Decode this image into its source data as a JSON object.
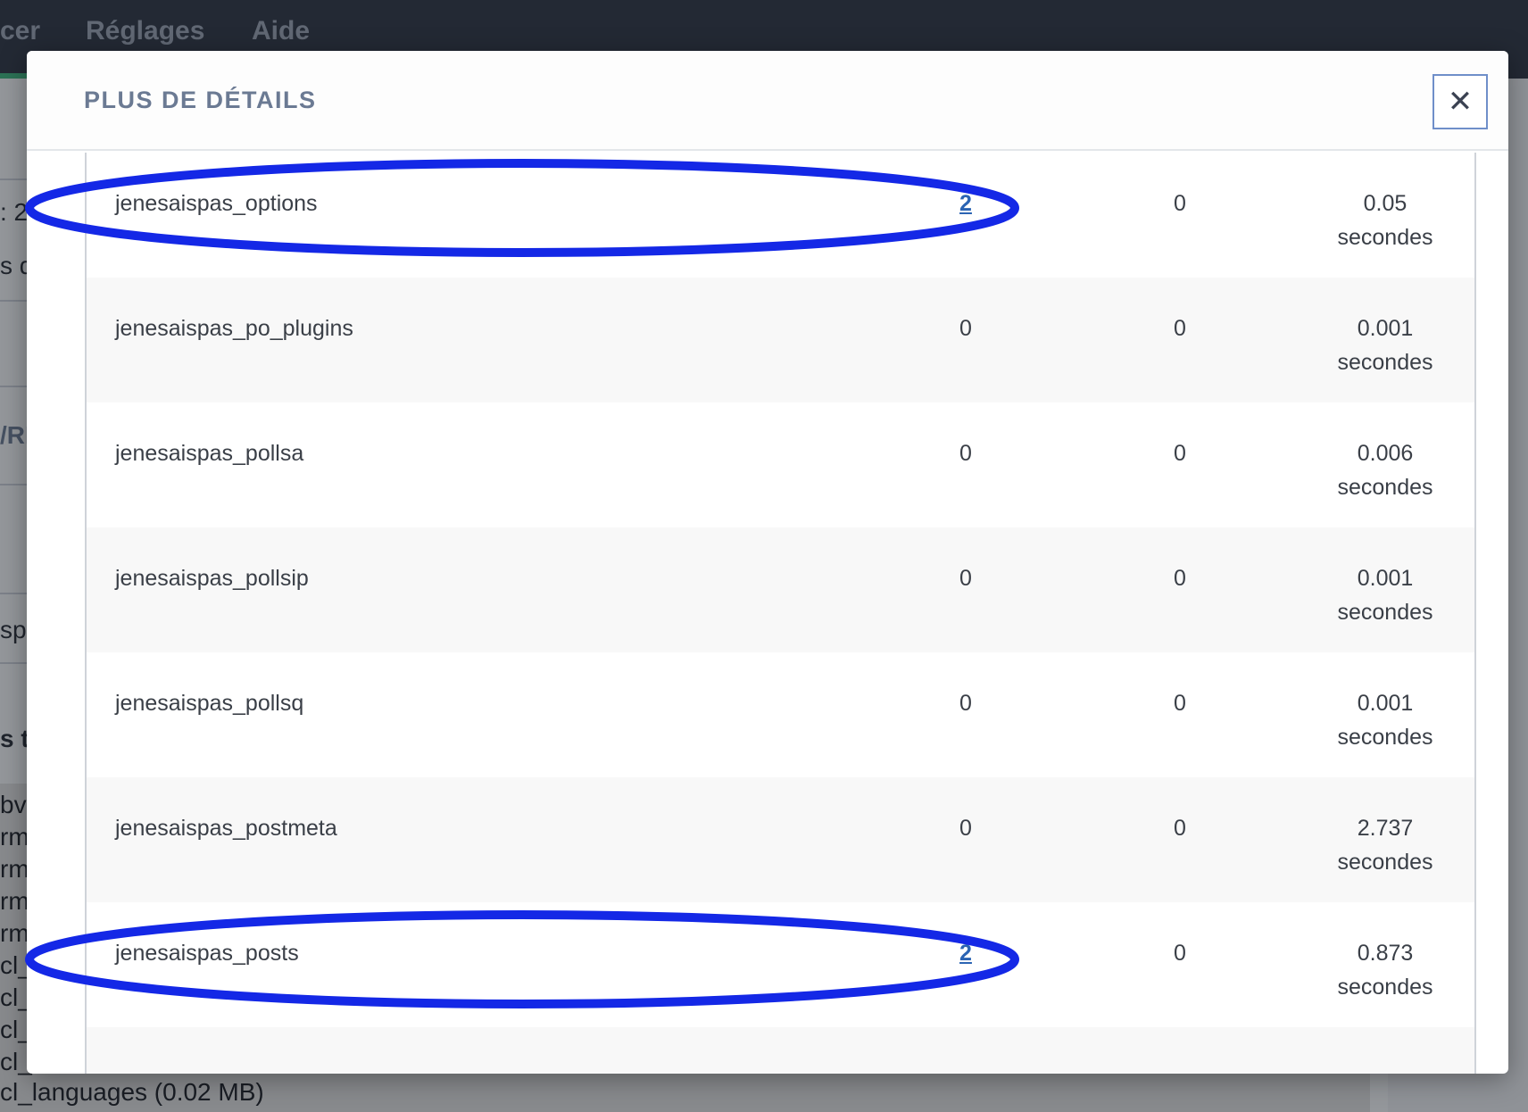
{
  "background": {
    "topbar_links": [
      "cer",
      "Réglages",
      "Aide"
    ],
    "fragments": [
      ": 2",
      "s d",
      "/RI",
      "sp",
      "s t"
    ],
    "list_lines": [
      "bva",
      "rm",
      "rm",
      "rm",
      "rm",
      "cl_",
      "cl_",
      "cl_",
      "cl_",
      "cl_languages (0.02 MB)"
    ]
  },
  "modal": {
    "title": "PLUS DE DÉTAILS",
    "close_label": "✕",
    "close_icon": "close-icon",
    "rows": [
      {
        "name": "jenesaispas_options",
        "col1": "2",
        "col1_link": true,
        "col2": "0",
        "time_value": "0.05",
        "time_unit": "secondes"
      },
      {
        "name": "jenesaispas_po_plugins",
        "col1": "0",
        "col1_link": false,
        "col2": "0",
        "time_value": "0.001",
        "time_unit": "secondes"
      },
      {
        "name": "jenesaispas_pollsa",
        "col1": "0",
        "col1_link": false,
        "col2": "0",
        "time_value": "0.006",
        "time_unit": "secondes"
      },
      {
        "name": "jenesaispas_pollsip",
        "col1": "0",
        "col1_link": false,
        "col2": "0",
        "time_value": "0.001",
        "time_unit": "secondes"
      },
      {
        "name": "jenesaispas_pollsq",
        "col1": "0",
        "col1_link": false,
        "col2": "0",
        "time_value": "0.001",
        "time_unit": "secondes"
      },
      {
        "name": "jenesaispas_postmeta",
        "col1": "0",
        "col1_link": false,
        "col2": "0",
        "time_value": "2.737",
        "time_unit": "secondes"
      },
      {
        "name": "jenesaispas_posts",
        "col1": "2",
        "col1_link": true,
        "col2": "0",
        "time_value": "0.873",
        "time_unit": "secondes"
      },
      {
        "name": "",
        "col1": "",
        "col1_link": false,
        "col2": "",
        "time_value": "",
        "time_unit": ""
      }
    ]
  },
  "annotations": {
    "color": "#1428e6",
    "highlighted_rows": [
      0,
      6
    ]
  }
}
